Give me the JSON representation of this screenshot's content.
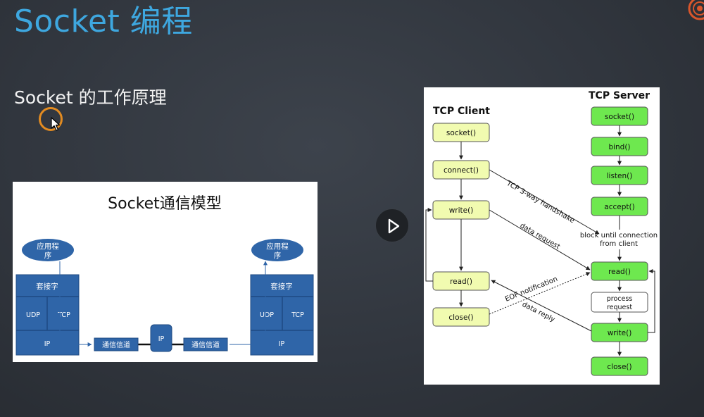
{
  "slide": {
    "title": "Socket 编程",
    "subtitle": "Socket 的工作原理"
  },
  "socket_model": {
    "title": "Socket通信模型",
    "left_app": [
      "应用程",
      "序"
    ],
    "right_app": [
      "应用程",
      "序"
    ],
    "socket_label": "套接字",
    "udp_label": "UDP",
    "tcp_label": "TCP",
    "ip_label": "IP",
    "channel_label": "通信信道",
    "router_label": "IP"
  },
  "tcp_flow": {
    "client_title": "TCP Client",
    "server_title": "TCP Server",
    "client_steps": [
      "socket()",
      "connect()",
      "write()",
      "read()",
      "close()"
    ],
    "server_steps": [
      "socket()",
      "bind()",
      "listen()",
      "accept()",
      "read()",
      "process request",
      "write()",
      "close()"
    ],
    "block_note_line1": "block until connection",
    "block_note_line2": "from client",
    "handshake_label": "TCP 3-way handshake",
    "data_request_label": "data request",
    "data_reply_label": "data reply",
    "eof_label": "EOF notification"
  },
  "colors": {
    "title_blue": "#3ea7df",
    "client_box": "#f1fbb0",
    "server_box": "#6ee84f",
    "model_blue": "#2f65a8"
  },
  "icons": {
    "play": "play-icon",
    "cursor": "cursor-arrow-icon"
  }
}
